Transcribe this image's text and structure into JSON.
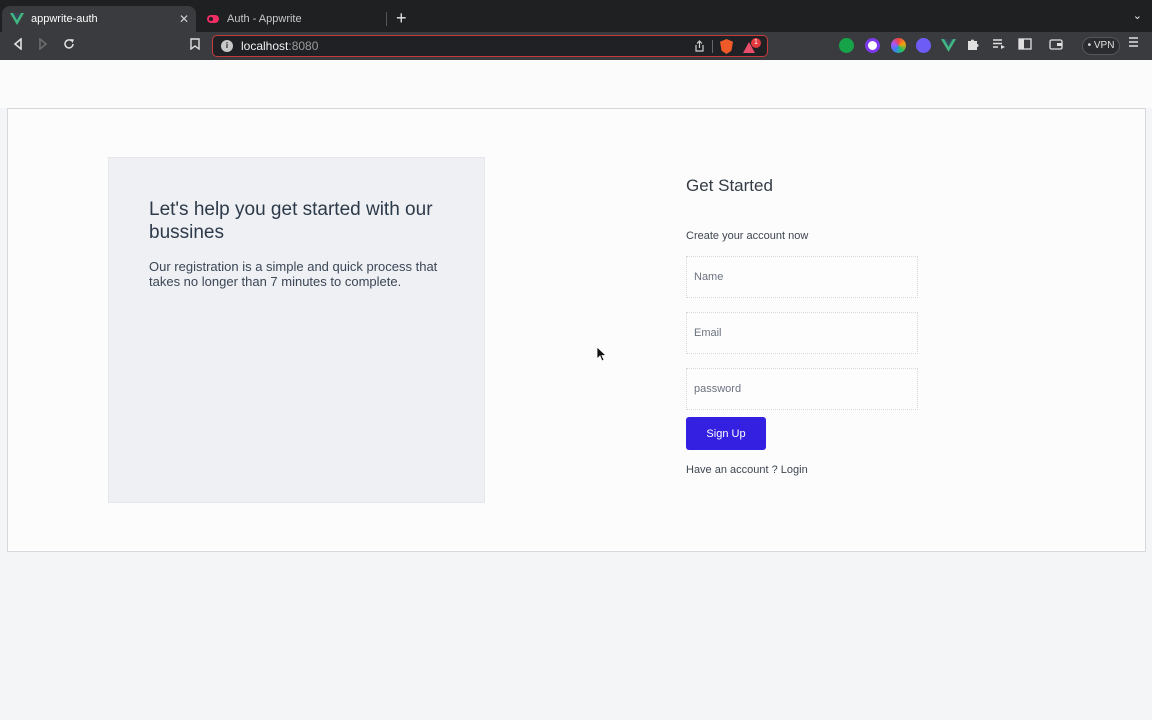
{
  "browser": {
    "tabs": [
      {
        "title": "appwrite-auth",
        "active": true,
        "close": "✕"
      },
      {
        "title": "Auth - Appwrite",
        "active": false
      }
    ],
    "new_tab": "+",
    "tab_menu": "⌄",
    "address": {
      "host": "localhost",
      "port": ":8080"
    },
    "rewards_count": "1",
    "vpn_label": "• VPN",
    "icons": {
      "back": "back-icon",
      "forward": "forward-icon",
      "reload": "reload-icon",
      "bookmark": "bookmark-icon",
      "share": "share-icon",
      "brave": "brave-shield-icon",
      "extensions": "puzzle-icon",
      "menu": "hamburger-menu-icon"
    },
    "colors": {
      "vue": "#41b883",
      "appwrite": "#f02e65",
      "address_border": "#c43b3b"
    }
  },
  "info": {
    "heading": "Let's help you get started with our bussines",
    "text": "Our registration is a simple and quick process that takes no longer than 7 minutes to complete."
  },
  "form": {
    "title": "Get Started",
    "subtitle": "Create your account now",
    "name_placeholder": "Name",
    "email_placeholder": "Email",
    "password_placeholder": "password",
    "submit_label": "Sign Up",
    "login_prompt": "Have an account ?",
    "login_link": "Login"
  },
  "colors": {
    "primary": "#3420e0"
  }
}
